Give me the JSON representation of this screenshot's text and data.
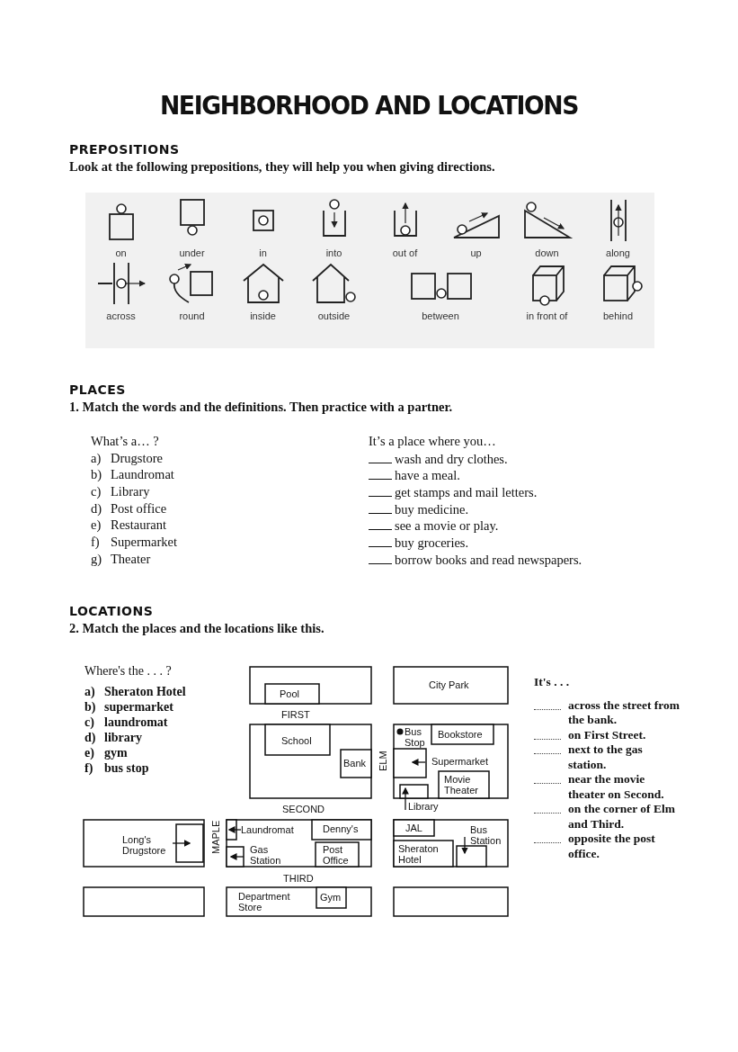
{
  "title": "NEIGHBORHOOD AND LOCATIONS",
  "prepositions": {
    "heading": "PREPOSITIONS",
    "instruction": "Look at the following prepositions, they will help you when giving directions.",
    "items": [
      {
        "label": "on"
      },
      {
        "label": "under"
      },
      {
        "label": "in"
      },
      {
        "label": "into"
      },
      {
        "label": "out of"
      },
      {
        "label": "up"
      },
      {
        "label": "down"
      },
      {
        "label": "along"
      },
      {
        "label": "across"
      },
      {
        "label": "round"
      },
      {
        "label": "inside"
      },
      {
        "label": "outside"
      },
      {
        "label": "between"
      },
      {
        "label": "in front of"
      },
      {
        "label": "behind"
      }
    ]
  },
  "places": {
    "heading": "PLACES",
    "instruction": "1. Match the words and the definitions. Then practice with a partner.",
    "words_title": "What’s a… ?",
    "words": [
      {
        "letter": "a)",
        "word": "Drugstore"
      },
      {
        "letter": "b)",
        "word": "Laundromat"
      },
      {
        "letter": "c)",
        "word": "Library"
      },
      {
        "letter": "d)",
        "word": "Post office"
      },
      {
        "letter": "e)",
        "word": "Restaurant"
      },
      {
        "letter": "f)",
        "word": "Supermarket"
      },
      {
        "letter": "g)",
        "word": "Theater"
      }
    ],
    "definitions_title": "It’s a place where you…",
    "definitions": [
      "wash and dry clothes.",
      "have a meal.",
      "get stamps and mail letters.",
      "buy medicine.",
      "see a movie or play.",
      "buy groceries.",
      "borrow books and read newspapers."
    ]
  },
  "locations": {
    "heading": "LOCATIONS",
    "instruction": "2. Match the places and the locations like this.",
    "places_title": "Where's the . . . ?",
    "places": [
      {
        "letter": "a)",
        "name": "Sheraton Hotel"
      },
      {
        "letter": "b)",
        "name": "supermarket"
      },
      {
        "letter": "c)",
        "name": "laundromat"
      },
      {
        "letter": "d)",
        "name": "library"
      },
      {
        "letter": "e)",
        "name": "gym"
      },
      {
        "letter": "f)",
        "name": "bus stop"
      }
    ],
    "map": {
      "labels": [
        "Pool",
        "City Park",
        "FIRST",
        "Bus Stop",
        "Bookstore",
        "School",
        "Bank",
        "ELM",
        "Supermarket",
        "Movie Theater",
        "Library",
        "SECOND",
        "Long's Drugstore",
        "MAPLE",
        "Laundromat",
        "Denny's",
        "JAL",
        "Bus Station",
        "Gas Station",
        "Post Office",
        "Sheraton Hotel",
        "THIRD",
        "Department Store",
        "Gym"
      ]
    },
    "answers_title": "It's . . .",
    "answers": [
      "across the street from the bank.",
      "on First Street.",
      "next to the gas station.",
      "near the movie theater on Second.",
      "on the corner of Elm and Third.",
      "opposite the post office."
    ]
  }
}
